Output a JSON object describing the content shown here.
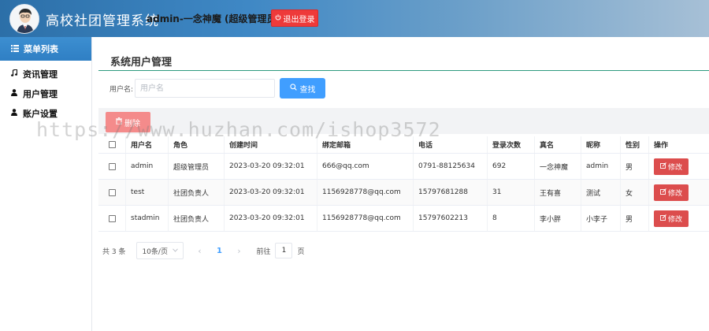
{
  "header": {
    "app_title": "高校社团管理系统",
    "user_info": "admin-一念神魔 (超级管理员)",
    "logout_label": "退出登录",
    "gradient_colors": [
      "#2c6fa8",
      "#a7c0d6"
    ],
    "logout_color": "#ee3a3a"
  },
  "sidebar": {
    "menu_title": "菜单列表",
    "items": [
      {
        "label": "资讯管理",
        "icon": "music-note-icon"
      },
      {
        "label": "用户管理",
        "icon": "user-icon"
      },
      {
        "label": "账户设置",
        "icon": "user-icon"
      }
    ]
  },
  "main": {
    "page_title": "系统用户管理",
    "search": {
      "label": "用户名:",
      "placeholder": "用户名",
      "value": "",
      "button_label": "查找"
    },
    "delete_label": "删除",
    "table": {
      "columns": [
        "用户名",
        "角色",
        "创建时间",
        "绑定邮箱",
        "电话",
        "登录次数",
        "真名",
        "昵称",
        "性别",
        "操作"
      ],
      "rows": [
        {
          "username": "admin",
          "role": "超级管理员",
          "created": "2023-03-20 09:32:01",
          "email": "666@qq.com",
          "phone": "0791-88125634",
          "logins": "692",
          "real_name": "一念神魔",
          "nickname": "admin",
          "gender": "男",
          "action": "修改"
        },
        {
          "username": "test",
          "role": "社团负责人",
          "created": "2023-03-20 09:32:01",
          "email": "1156928778@qq.com",
          "phone": "15797681288",
          "logins": "31",
          "real_name": "王有喜",
          "nickname": "测试",
          "gender": "女",
          "action": "修改"
        },
        {
          "username": "stadmin",
          "role": "社团负责人",
          "created": "2023-03-20 09:32:01",
          "email": "1156928778@qq.com",
          "phone": "15797602213",
          "logins": "8",
          "real_name": "李小胖",
          "nickname": "小李子",
          "gender": "男",
          "action": "修改"
        }
      ]
    },
    "pagination": {
      "total": "共 3 条",
      "page_size": "10条/页",
      "current_page": "1",
      "goto_prefix": "前往",
      "goto_value": "1",
      "goto_suffix": "页"
    }
  },
  "watermark": "https://www.huzhan.com/ishop3572",
  "colors": {
    "primary": "#409eff",
    "danger": "#dc4d4d",
    "accent_line": "#2f9a7f"
  }
}
